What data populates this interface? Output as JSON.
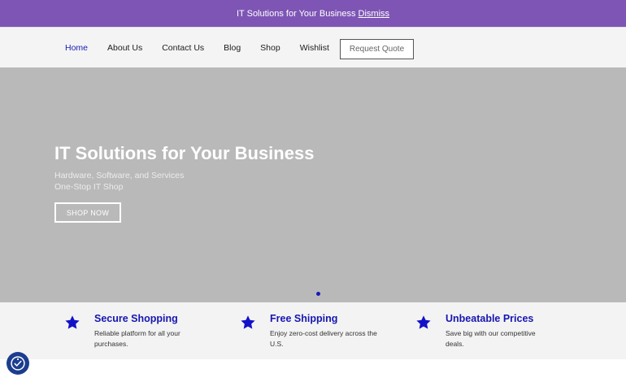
{
  "notice": {
    "text": "IT Solutions for Your Business",
    "dismiss_label": "Dismiss"
  },
  "nav": {
    "items": [
      {
        "label": "Home",
        "active": true
      },
      {
        "label": "About Us"
      },
      {
        "label": "Contact Us"
      },
      {
        "label": "Blog"
      },
      {
        "label": "Shop"
      },
      {
        "label": "Wishlist"
      }
    ],
    "cta_label": "Request Quote"
  },
  "hero": {
    "title": "IT Solutions for Your Business",
    "subtitle_line1": "Hardware, Software, and Services",
    "subtitle_line2": "One-Stop IT Shop",
    "button_label": "SHOP NOW"
  },
  "features": [
    {
      "title": "Secure Shopping",
      "description": "Reliable platform for all your purchases.",
      "icon": "star-icon"
    },
    {
      "title": "Free Shipping",
      "description": "Enjoy zero-cost delivery across the U.S.",
      "icon": "star-icon"
    },
    {
      "title": "Unbeatable Prices",
      "description": "Save big with our competitive deals.",
      "icon": "star-icon"
    }
  ],
  "colors": {
    "notice_bg": "#7e55b5",
    "accent": "#1a1ab8",
    "hero_bg": "#b9b9b9",
    "features_bg": "#f3f3f3"
  }
}
